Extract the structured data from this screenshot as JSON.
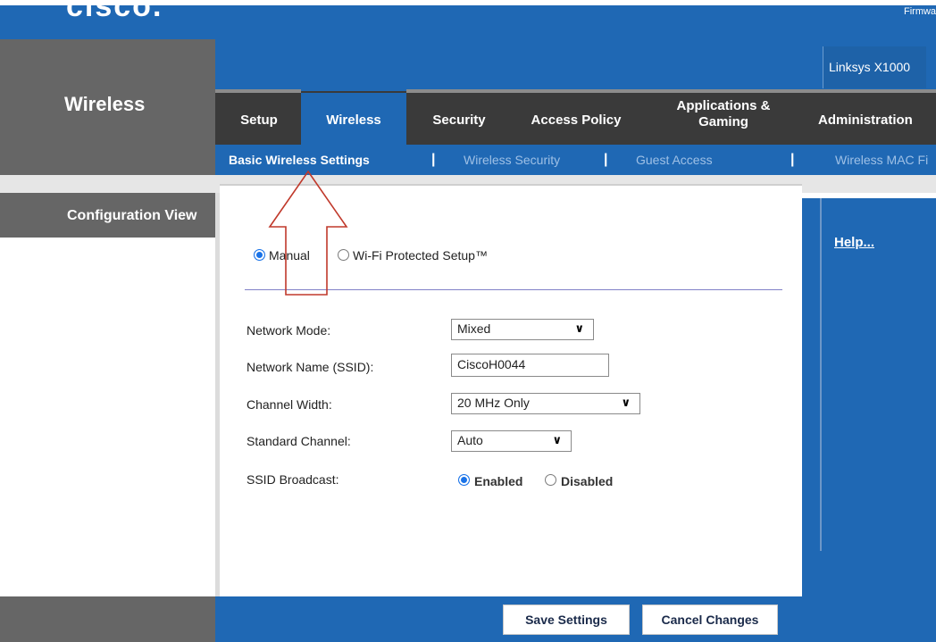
{
  "brand": {
    "logo_text": "cisco."
  },
  "firmware_label": "Firmwa",
  "model_name": "Linksys X1000",
  "section_title": "Wireless",
  "left_panel": {
    "config_view_label": "Configuration View"
  },
  "tabs": [
    {
      "label": "Setup"
    },
    {
      "label": "Wireless"
    },
    {
      "label": "Security"
    },
    {
      "label": "Access Policy"
    },
    {
      "label": "Applications &\nGaming"
    },
    {
      "label": "Administration"
    }
  ],
  "subnav": {
    "items": [
      {
        "label": "Basic Wireless Settings"
      },
      {
        "label": "Wireless Security"
      },
      {
        "label": "Guest Access"
      },
      {
        "label": "Wireless MAC Fi"
      }
    ],
    "separator": "|"
  },
  "setup_mode": {
    "manual_label": "Manual",
    "wps_label": "Wi-Fi Protected Setup™",
    "selected": "Manual"
  },
  "form": {
    "network_mode": {
      "label": "Network Mode:",
      "value": "Mixed"
    },
    "ssid": {
      "label": "Network Name (SSID):",
      "value": "CiscoH0044"
    },
    "channel_width": {
      "label": "Channel Width:",
      "value": "20 MHz Only"
    },
    "standard_channel": {
      "label": "Standard Channel:",
      "value": "Auto"
    },
    "ssid_broadcast": {
      "label": "SSID Broadcast:",
      "enabled_label": "Enabled",
      "disabled_label": "Disabled",
      "selected": "Enabled"
    }
  },
  "help_link": "Help...",
  "buttons": {
    "save": "Save Settings",
    "cancel": "Cancel Changes"
  },
  "icons": {
    "dropdown": "chevron-down-icon",
    "annotation": "red-up-arrow"
  },
  "colors": {
    "brand_blue": "#1f68b4",
    "dark_gray": "#666666",
    "tab_bar": "#3a3a3a",
    "radio_selected": "#1a73e8",
    "annotation_arrow": "#c0392b"
  }
}
